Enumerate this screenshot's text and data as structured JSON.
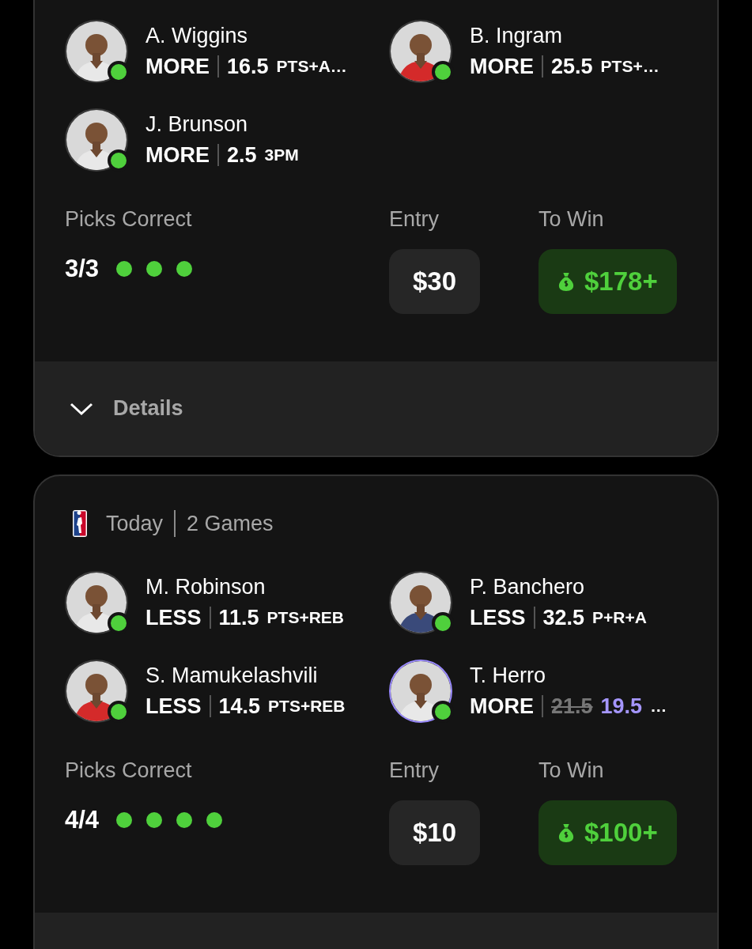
{
  "cards": [
    {
      "picks": [
        {
          "name": "A. Wiggins",
          "direction": "MORE",
          "line": "16.5",
          "stat": "PTS+A…",
          "correct": true,
          "highlighted": false
        },
        {
          "name": "B. Ingram",
          "direction": "MORE",
          "line": "25.5",
          "stat": "PTS+…",
          "correct": true,
          "highlighted": false
        },
        {
          "name": "J. Brunson",
          "direction": "MORE",
          "line": "2.5",
          "stat": "3PM",
          "correct": true,
          "highlighted": false
        }
      ],
      "summary": {
        "label": "Picks Correct",
        "score": "3/3",
        "dots": [
          {
            "correct": true
          },
          {
            "correct": true
          },
          {
            "correct": true
          }
        ],
        "entry_label": "Entry",
        "entry": "$30",
        "win_label": "To Win",
        "to_win": "$178+"
      },
      "footer": {
        "label": "Details",
        "expanded": false
      }
    },
    {
      "header": {
        "date": "Today",
        "games": "2 Games"
      },
      "picks": [
        {
          "name": "M. Robinson",
          "direction": "LESS",
          "line": "11.5",
          "stat": "PTS+REB",
          "correct": true,
          "highlighted": false
        },
        {
          "name": "P. Banchero",
          "direction": "LESS",
          "line": "32.5",
          "stat": "P+R+A",
          "correct": true,
          "highlighted": false
        },
        {
          "name": "S. Mamukelashvili",
          "direction": "LESS",
          "line": "14.5",
          "stat": "PTS+REB",
          "correct": true,
          "highlighted": false
        },
        {
          "name": "T. Herro",
          "direction": "MORE",
          "old_line": "21.5",
          "line": "19.5",
          "stat": "…",
          "correct": true,
          "highlighted": true
        }
      ],
      "summary": {
        "label": "Picks Correct",
        "score": "4/4",
        "dots": [
          {
            "correct": true
          },
          {
            "correct": true
          },
          {
            "correct": true
          },
          {
            "correct": true
          }
        ],
        "entry_label": "Entry",
        "entry": "$10",
        "win_label": "To Win",
        "to_win": "$100+"
      }
    }
  ]
}
